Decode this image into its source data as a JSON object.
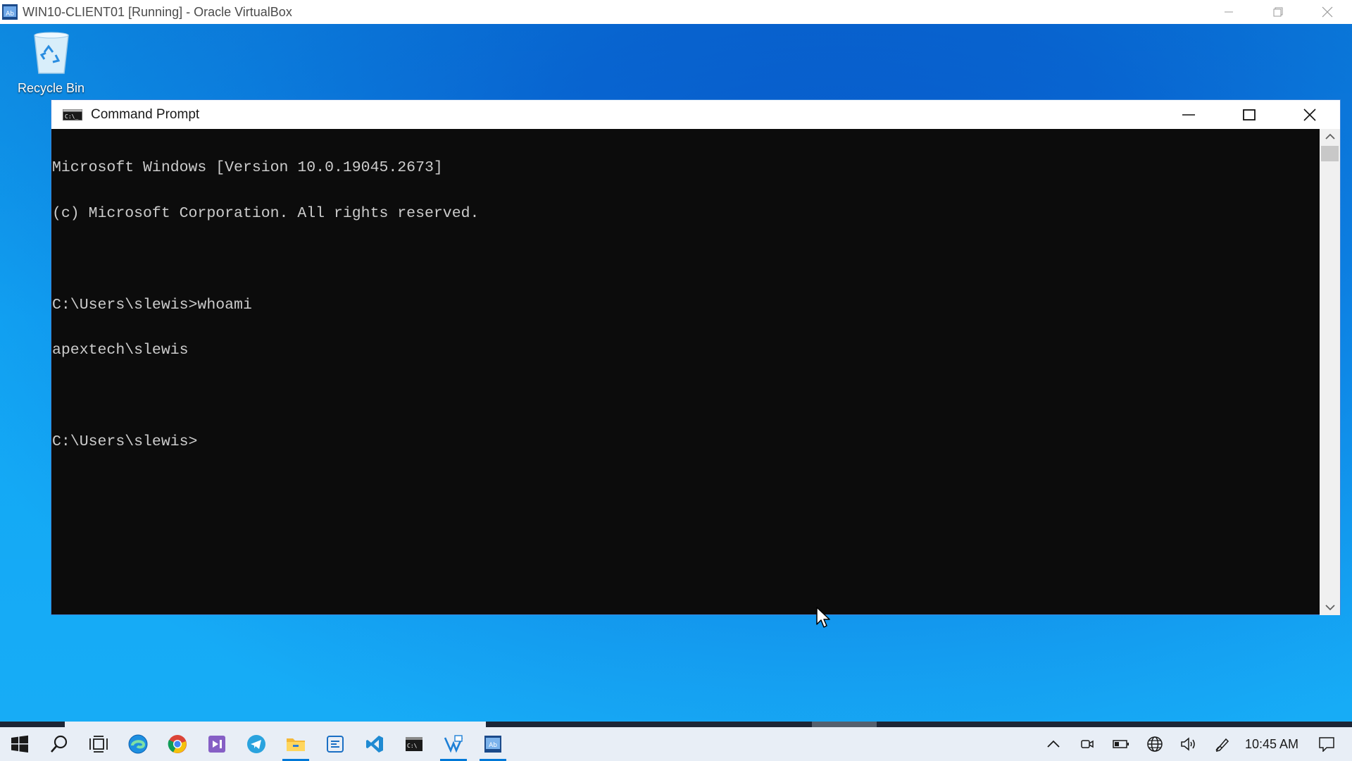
{
  "host": {
    "title": "WIN10-CLIENT01 [Running] - Oracle VirtualBox",
    "icon": "virtualbox-icon"
  },
  "desktop": {
    "icons": [
      {
        "label": "Recycle Bin",
        "icon": "recycle-bin-icon"
      }
    ]
  },
  "cmd_window": {
    "title": "Command Prompt",
    "lines": [
      "Microsoft Windows [Version 10.0.19045.2673]",
      "(c) Microsoft Corporation. All rights reserved.",
      "",
      "C:\\Users\\slewis>whoami",
      "apextech\\slewis",
      "",
      "C:\\Users\\slewis>"
    ]
  },
  "taskbar": {
    "items": [
      {
        "name": "start",
        "icon": "windows-logo-icon",
        "active": false
      },
      {
        "name": "search",
        "icon": "search-icon",
        "active": false
      },
      {
        "name": "task-view",
        "icon": "task-view-icon",
        "active": false
      },
      {
        "name": "edge",
        "icon": "edge-icon",
        "active": false
      },
      {
        "name": "chrome",
        "icon": "chrome-icon",
        "active": false
      },
      {
        "name": "visual-studio",
        "icon": "visual-studio-icon",
        "active": false
      },
      {
        "name": "telegram",
        "icon": "telegram-icon",
        "active": false
      },
      {
        "name": "file-explorer",
        "icon": "folder-icon",
        "active": true
      },
      {
        "name": "app-grid",
        "icon": "app-icon",
        "active": false
      },
      {
        "name": "vscode",
        "icon": "vscode-icon",
        "active": false
      },
      {
        "name": "terminal",
        "icon": "terminal-icon",
        "active": false
      },
      {
        "name": "vs-installer",
        "icon": "vs-installer-icon",
        "active": true
      },
      {
        "name": "virtualbox",
        "icon": "virtualbox-icon",
        "active": true
      }
    ],
    "tray": {
      "icons": [
        "chevron-up-icon",
        "meet-now-icon",
        "battery-icon",
        "network-globe-icon",
        "speaker-icon",
        "pen-icon"
      ],
      "clock": "10:45 AM",
      "notification_icon": "notification-icon"
    }
  },
  "colors": {
    "accent": "#0078d7",
    "console_bg": "#0c0c0c",
    "console_fg": "#cccccc"
  }
}
